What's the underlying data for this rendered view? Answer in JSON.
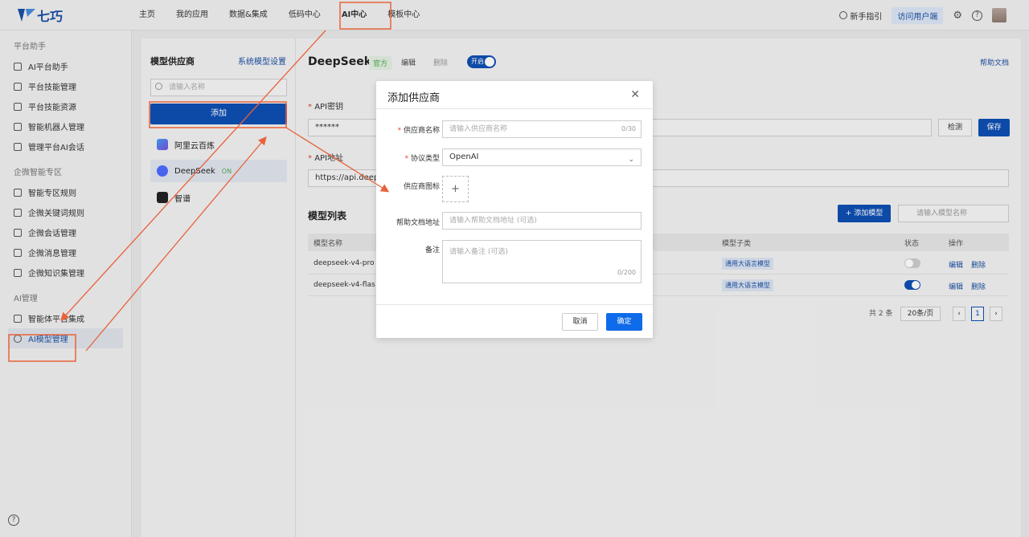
{
  "brand": {
    "name": "七巧"
  },
  "topnav": {
    "tabs": [
      "主页",
      "我的应用",
      "数据&集成",
      "低码中心",
      "AI中心",
      "模板中心"
    ],
    "guide": "新手指引",
    "visit": "访问用户端"
  },
  "sidebar": {
    "sections": [
      {
        "title": "平台助手",
        "items": [
          "AI平台助手",
          "平台技能管理",
          "平台技能资源",
          "智能机器人管理",
          "管理平台AI会话"
        ]
      },
      {
        "title": "企微智能专区",
        "items": [
          "智能专区规则",
          "企微关键词规则",
          "企微会话管理",
          "企微消息管理",
          "企微知识集管理"
        ]
      },
      {
        "title": "AI管理",
        "items": [
          "智能体平台集成",
          "AI模型管理"
        ]
      }
    ]
  },
  "providers": {
    "title": "模型供应商",
    "settings": "系统模型设置",
    "search_placeholder": "请输入名称",
    "add": "添加",
    "items": [
      {
        "name": "阿里云百炼"
      },
      {
        "name": "DeepSeek",
        "status": "ON"
      },
      {
        "name": "智谱"
      }
    ]
  },
  "detail": {
    "title": "DeepSeek",
    "tag": "官方",
    "edit": "编辑",
    "delete": "删除",
    "switch": "开启",
    "doc": "帮助文档",
    "api_key_label": "API密钥",
    "api_key_value": "******",
    "check": "检测",
    "save": "保存",
    "api_url_label": "API地址",
    "api_url_value": "https://api.deeps",
    "models_title": "模型列表",
    "add_model": "添加模型",
    "model_search_placeholder": "请输入模型名称",
    "columns": [
      "模型名称",
      "模型子类",
      "状态",
      "操作"
    ],
    "rows": [
      {
        "name": "deepseek-v4-pro",
        "sub": "通用大语言模型",
        "edit": "编辑",
        "delete": "删除"
      },
      {
        "name": "deepseek-v4-flas",
        "sub": "通用大语言模型",
        "edit": "编辑",
        "delete": "删除"
      }
    ],
    "pager": {
      "total": "共 2 条",
      "size": "20条/页",
      "page": "1"
    }
  },
  "modal": {
    "title": "添加供应商",
    "name_label": "供应商名称",
    "name_placeholder": "请输入供应商名称",
    "name_count": "0/30",
    "protocol_label": "协议类型",
    "protocol_value": "OpenAI",
    "icon_label": "供应商图标",
    "doc_label": "帮助文档地址",
    "doc_placeholder": "请输入帮助文档地址 (可选)",
    "remark_label": "备注",
    "remark_placeholder": "请输入备注 (可选)",
    "remark_count": "0/200",
    "cancel": "取消",
    "ok": "确定"
  }
}
